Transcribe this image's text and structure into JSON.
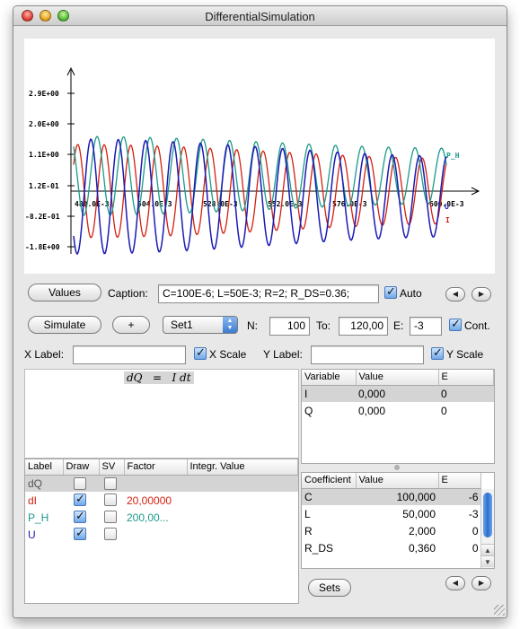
{
  "window": {
    "title": "DifferentialSimulation"
  },
  "plot": {
    "y_ticks": [
      "2.9E+00",
      "2.0E+00",
      "1.1E+00",
      "1.2E-01",
      "-8.2E-01",
      "-1.8E+00"
    ],
    "x_ticks": [
      "480.0E-3",
      "504.0E-3",
      "528.0E-3",
      "552.0E-3",
      "576.0E-3",
      "600.0E-3"
    ],
    "labels": {
      "p_h": "P_H",
      "u": "U",
      "i": "I"
    },
    "colors": {
      "i": "#d42010",
      "p_h": "#1a9a8a",
      "u": "#1a1ab4"
    }
  },
  "controls": {
    "values_button": "Values",
    "caption_label": "Caption:",
    "caption_value": "C=100E-6; L=50E-3; R=2; R_DS=0.36;",
    "auto_label": "Auto",
    "simulate_button": "Simulate",
    "plus_button": "+",
    "set_popup": "Set1",
    "n_label": "N:",
    "n_value": "100",
    "to_label": "To:",
    "to_value": "120,00",
    "e_label": "E:",
    "e_value": "-3",
    "cont_label": "Cont.",
    "xlabel_label": "X Label:",
    "xscale_label": "X Scale",
    "ylabel_label": "Y Label:",
    "yscale_label": "Y Scale",
    "sets_button": "Sets"
  },
  "equation": {
    "lhs": "dQ",
    "eq": "=",
    "rhs": "I dt"
  },
  "variables": {
    "headers": [
      "Variable",
      "Value",
      "E"
    ],
    "rows": [
      {
        "name": "I",
        "value": "0,000",
        "e": "0"
      },
      {
        "name": "Q",
        "value": "0,000",
        "e": "0"
      }
    ]
  },
  "labels_table": {
    "headers": [
      "Label",
      "Draw",
      "SV",
      "Factor",
      "Integr. Value"
    ],
    "rows": [
      {
        "label": "dQ",
        "factor": "",
        "color": "#555555"
      },
      {
        "label": "dI",
        "factor": "20,00000",
        "color": "#d42010"
      },
      {
        "label": "P_H",
        "factor": "200,00...",
        "color": "#1a9a8a"
      },
      {
        "label": "U",
        "factor": "",
        "color": "#1a1ab4"
      }
    ]
  },
  "coefficients": {
    "headers": [
      "Coefficient",
      "Value",
      "E"
    ],
    "rows": [
      {
        "name": "C",
        "value": "100,000",
        "e": "-6"
      },
      {
        "name": "L",
        "value": "50,000",
        "e": "-3"
      },
      {
        "name": "R",
        "value": "2,000",
        "e": "0"
      },
      {
        "name": "R_DS",
        "value": "0,360",
        "e": "0"
      }
    ]
  }
}
